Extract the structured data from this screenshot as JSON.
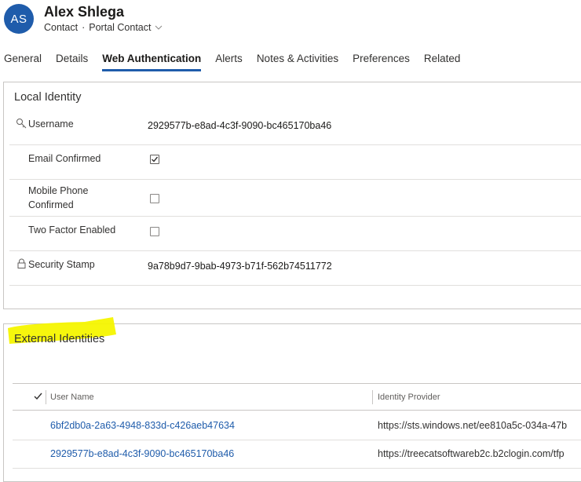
{
  "record": {
    "initials": "AS",
    "name": "Alex Shlega",
    "entity": "Contact",
    "separator": "·",
    "form": "Portal Contact"
  },
  "tabs": [
    {
      "label": "General"
    },
    {
      "label": "Details"
    },
    {
      "label": "Web Authentication"
    },
    {
      "label": "Alerts"
    },
    {
      "label": "Notes & Activities"
    },
    {
      "label": "Preferences"
    },
    {
      "label": "Related"
    }
  ],
  "local_identity": {
    "title": "Local Identity",
    "username_label": "Username",
    "username_value": "2929577b-e8ad-4c3f-9090-bc465170ba46",
    "email_confirmed_label": "Email Confirmed",
    "email_confirmed": true,
    "mobile_confirmed_label_1": "Mobile Phone",
    "mobile_confirmed_label_2": "Confirmed",
    "mobile_confirmed": false,
    "two_factor_label": "Two Factor Enabled",
    "two_factor": false,
    "security_stamp_label": "Security Stamp",
    "security_stamp_value": "9a78b9d7-9bab-4973-b71f-562b74511772"
  },
  "external_identities": {
    "title": "External Identities",
    "highlight_color": "#f5f500",
    "columns": [
      "User Name",
      "Identity Provider"
    ],
    "rows": [
      {
        "user_name": "6bf2db0a-2a63-4948-833d-c426aeb47634",
        "provider": "https://sts.windows.net/ee810a5c-034a-47b"
      },
      {
        "user_name": "2929577b-e8ad-4c3f-9090-bc465170ba46",
        "provider": "https://treecatsoftwareb2c.b2clogin.com/tfp"
      }
    ]
  },
  "colors": {
    "accent": "#1f5cab",
    "link": "#1f5cab"
  }
}
